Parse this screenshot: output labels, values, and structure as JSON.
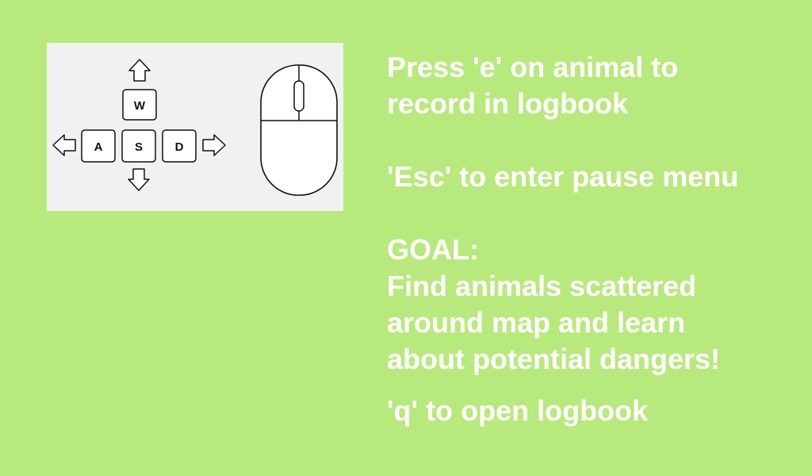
{
  "controls_image": {
    "keys": {
      "up": "W",
      "left": "A",
      "down": "S",
      "right": "D"
    },
    "icons": [
      "arrow-up-icon",
      "arrow-left-icon",
      "arrow-down-icon",
      "arrow-right-icon",
      "mouse-icon"
    ]
  },
  "instructions": {
    "record_line_1": "Press 'e' on animal to",
    "record_line_2": "record in logbook",
    "pause": "'Esc' to enter pause menu",
    "goal_heading": "GOAL:",
    "goal_line_1": "Find animals scattered",
    "goal_line_2": "around map and learn",
    "goal_line_3": "about potential dangers!",
    "logbook": "'q' to open logbook"
  },
  "colors": {
    "background": "#b8e97d",
    "panel": "#f1f1f1",
    "text": "#ffffff"
  }
}
